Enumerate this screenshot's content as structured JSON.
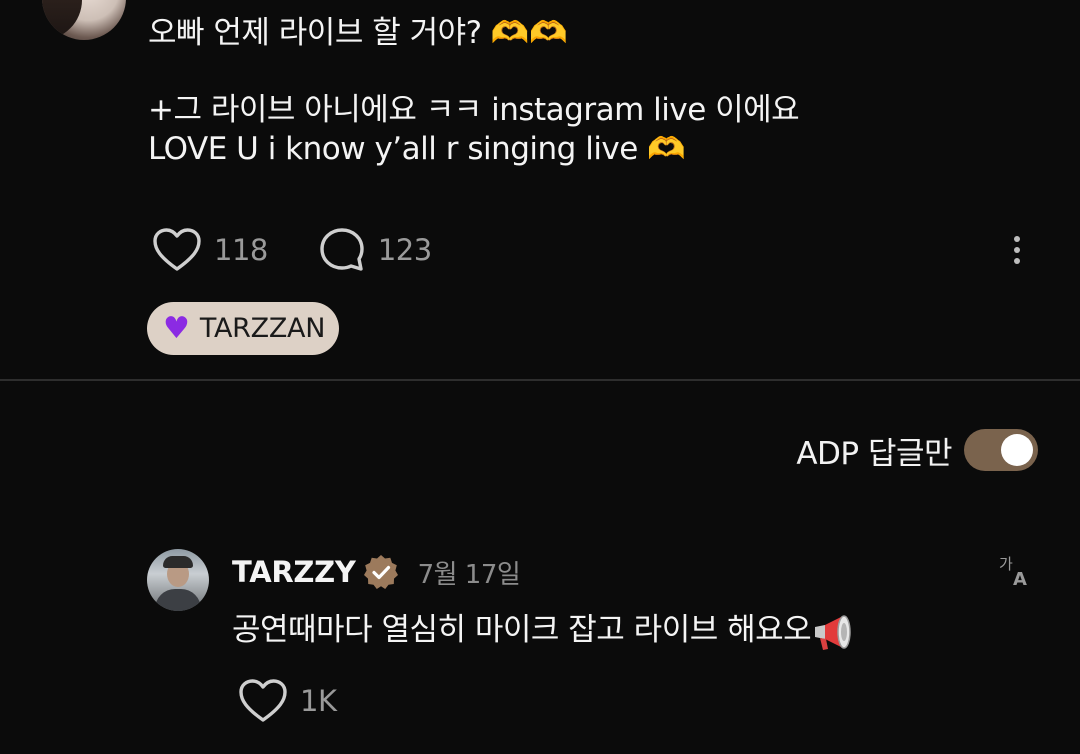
{
  "comment": {
    "lines": [
      "오빠 언제 라이브 할 거야? 🫶🫶",
      "+그 라이브 아니에요 ㅋㅋ instagram live 이에요",
      "LOVE U i know y’all r singing live 🫶"
    ],
    "likes": "118",
    "replies": "123"
  },
  "tag": {
    "icon": "purple-heart-icon",
    "label": "TARZZAN",
    "heart_color": "#8b2be3",
    "chip_color": "#ddd1c6"
  },
  "filter": {
    "label": "ADP 답글만",
    "toggle_on": true,
    "toggle_color": "#7a634d"
  },
  "reply": {
    "username": "TARZZY",
    "date": "7월 17일",
    "text": "공연때마다 열심히 마이크 잡고 라이브 해요오",
    "likes": "1K",
    "badge_color": "#9c7a5c"
  }
}
